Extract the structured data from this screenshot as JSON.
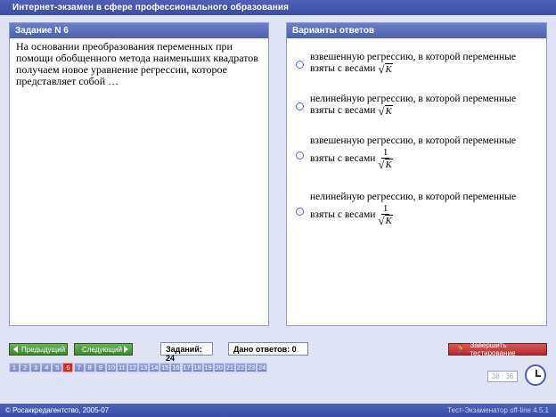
{
  "window": {
    "title": "Интернет-экзамен в сфере профессионального образования"
  },
  "task_panel": {
    "header": "Задание N 6",
    "question": "На основании преобразования переменных при помощи обобщенного метода  наименьших квадратов получаем новое уравнение регрессии, которое представляет собой …"
  },
  "answers_panel": {
    "header": "Варианты ответов",
    "options": [
      {
        "line1": "взвешенную регрессию, в которой переменные",
        "line2": "взяты с весами",
        "formula_num": "",
        "formula_var": "K"
      },
      {
        "line1": "нелинейную регрессию, в которой переменные",
        "line2": "взяты с весами",
        "formula_num": "",
        "formula_var": "K"
      },
      {
        "line1": "взвешенную регрессию, в которой переменные",
        "line2": "взяты с весами",
        "formula_num": "1",
        "formula_var": "K"
      },
      {
        "line1": "нелинейную регрессию, в которой переменные",
        "line2": "взяты с весами",
        "formula_num": "1",
        "formula_var": "K"
      }
    ]
  },
  "nav": {
    "prev_label": "Предыдущий",
    "next_label": "Следующий",
    "tasks_label": "Заданий: 24",
    "answered_label": "Дано ответов: 0",
    "finish_label": "Завершить тестирование"
  },
  "pages": [
    "1",
    "2",
    "3",
    "4",
    "5",
    "6",
    "7",
    "8",
    "9",
    "10",
    "11",
    "12",
    "13",
    "14",
    "15",
    "16",
    "17",
    "18",
    "19",
    "20",
    "21",
    "22",
    "23",
    "24"
  ],
  "current_page": 6,
  "timer": {
    "value": "38 : 36"
  },
  "footer": {
    "copyright": "© Росаккредагентство, 2005-07",
    "version": "Тест-Экзаменатор off-line 4.5.1"
  },
  "colors": {
    "accent": "#4a5fb0",
    "current_page": "#c9302c",
    "nav_button": "#3d8a2c",
    "finish_button": "#b12d2d"
  }
}
